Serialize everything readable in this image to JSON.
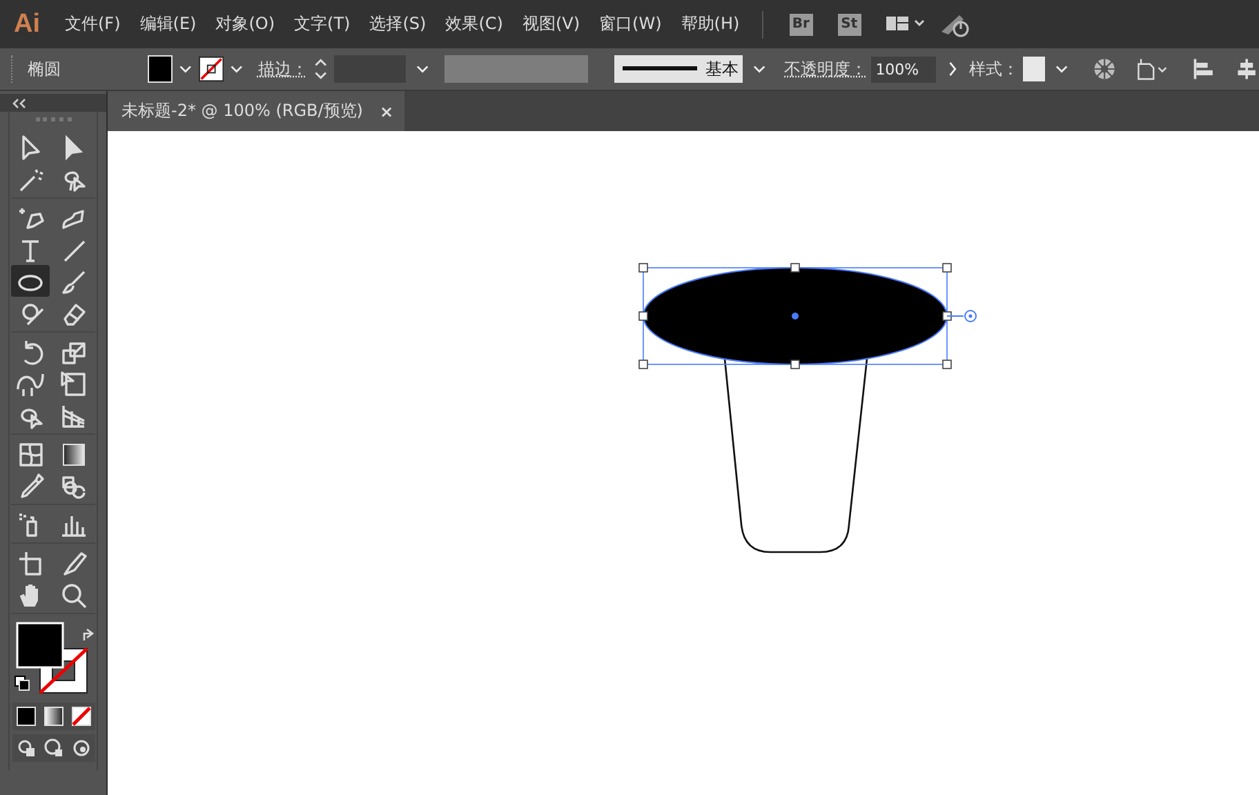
{
  "app": {
    "logo": "Ai"
  },
  "menu": [
    "文件(F)",
    "编辑(E)",
    "对象(O)",
    "文字(T)",
    "选择(S)",
    "效果(C)",
    "视图(V)",
    "窗口(W)",
    "帮助(H)"
  ],
  "bridge_buttons": [
    "Br",
    "St"
  ],
  "control_bar": {
    "object_type": "椭圆",
    "stroke_label": "描边：",
    "stroke_profile": "基本",
    "opacity_label": "不透明度：",
    "opacity_value": "100%",
    "style_label": "样式："
  },
  "document_tab": {
    "title": "未标题-2* @ 100% (RGB/预览)",
    "close": "×"
  },
  "tool_groups": [
    [
      {
        "kind": "selection",
        "selected": false
      },
      {
        "kind": "direct",
        "selected": false
      },
      {
        "kind": "wand",
        "selected": false
      },
      {
        "kind": "lasso",
        "selected": false
      }
    ],
    [
      {
        "kind": "pen",
        "selected": false
      },
      {
        "kind": "curvature",
        "selected": false
      },
      {
        "kind": "type",
        "selected": false
      },
      {
        "kind": "line",
        "selected": false
      },
      {
        "kind": "ellipse",
        "selected": true
      },
      {
        "kind": "brush",
        "selected": false
      },
      {
        "kind": "shaper",
        "selected": false
      },
      {
        "kind": "eraser",
        "selected": false
      }
    ],
    [
      {
        "kind": "rotate",
        "selected": false
      },
      {
        "kind": "scale",
        "selected": false
      },
      {
        "kind": "puppet",
        "selected": false
      },
      {
        "kind": "transform",
        "selected": false
      },
      {
        "kind": "builder",
        "selected": false
      },
      {
        "kind": "perspective",
        "selected": false
      }
    ],
    [
      {
        "kind": "mesh",
        "selected": false
      },
      {
        "kind": "gradient",
        "selected": false
      },
      {
        "kind": "eyedropper",
        "selected": false
      },
      {
        "kind": "blend",
        "selected": false
      }
    ],
    [
      {
        "kind": "sprayer",
        "selected": false
      },
      {
        "kind": "graph",
        "selected": false
      }
    ],
    [
      {
        "kind": "artboard",
        "selected": false
      },
      {
        "kind": "slice",
        "selected": false
      },
      {
        "kind": "hand",
        "selected": false
      },
      {
        "kind": "zoom",
        "selected": false
      }
    ]
  ],
  "canvas": {
    "ellipse_selected": true
  }
}
